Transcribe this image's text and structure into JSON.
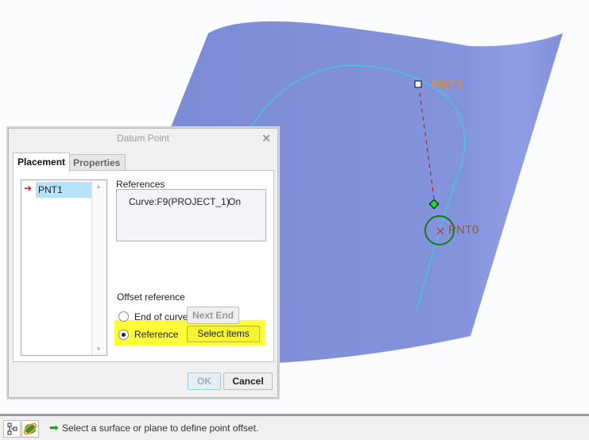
{
  "graphics": {
    "point_label_1": "PNT1",
    "point_label_0": "PNT0",
    "surface_color": "#7f8fd8",
    "curve_color": "#2fd8e8"
  },
  "dialog": {
    "title": "Datum Point",
    "tabs": [
      "Placement",
      "Properties"
    ],
    "list_items": [
      "PNT1"
    ],
    "references_label": "References",
    "references": [
      {
        "name": "Curve:F9(PROJECT_1)",
        "status": "On"
      }
    ],
    "offset_label": "Offset reference",
    "option_end": "End of curve",
    "next_end": "Next End",
    "option_reference": "Reference",
    "select_items": "Select items",
    "ok": "OK",
    "cancel": "Cancel"
  },
  "status": {
    "message": "Select a surface or plane to define point offset."
  }
}
